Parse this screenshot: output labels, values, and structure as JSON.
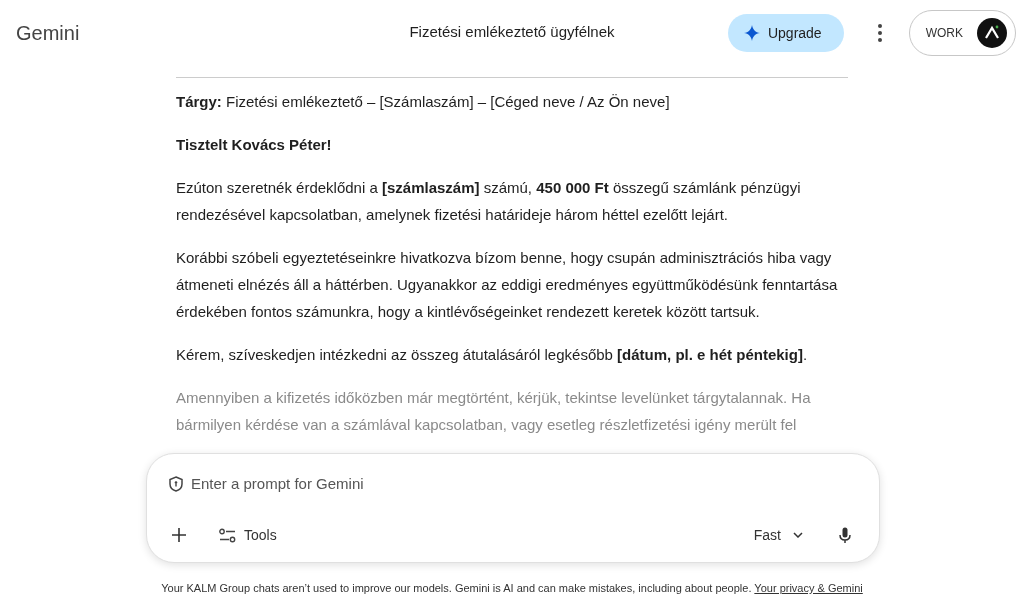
{
  "header": {
    "app_name": "Gemini",
    "chat_title": "Fizetési emlékeztető ügyfélnek",
    "upgrade_button": "Upgrade",
    "account_label": "WORK"
  },
  "message": {
    "paragraphs": [
      {
        "kind": "normal",
        "text": "**Tárgy:** Fizetési emlékeztető – [Számlaszám] – [Céged neve / Az Ön neve]"
      },
      {
        "kind": "heading",
        "text": "Tisztelt Kovács Péter!"
      },
      {
        "kind": "normal",
        "text": "Ezúton szeretnék érdeklődni a **[számlaszám]** számú, **450 000 Ft** összegű számlánk pénzügyi rendezésével kapcsolatban, amelynek fizetési határideje három héttel ezelőtt lejárt."
      },
      {
        "kind": "normal",
        "text": "Korábbi szóbeli egyeztetéseinkre hivatkozva bízom benne, hogy csupán adminisztrációs hiba vagy átmeneti elnézés áll a háttérben. Ugyanakkor az eddigi eredményes együttműködésünk fenntartása érdekében fontos számunkra, hogy a kintlévőségeinket rendezett keretek között tartsuk."
      },
      {
        "kind": "normal",
        "text": "Kérem, szíveskedjen intézkedni az összeg átutalásáról legkésőbb **[dátum, pl. e hét péntekig]**."
      },
      {
        "kind": "faded",
        "text": "Amennyiben a kifizetés időközben már megtörtént, kérjük, tekintse levelünket tárgytalannak. Ha bármilyen kérdése van a számlával kapcsolatban, vagy esetleg részletfizetési igény merült fel"
      }
    ]
  },
  "composer": {
    "placeholder": "Enter a prompt for Gemini",
    "tools_label": "Tools",
    "mode_label": "Fast"
  },
  "footer": {
    "notice": "Your KALM Group chats aren’t used to improve our models. Gemini is AI and can make mistakes, including about people.",
    "privacy_link": "Your privacy & Gemini"
  }
}
